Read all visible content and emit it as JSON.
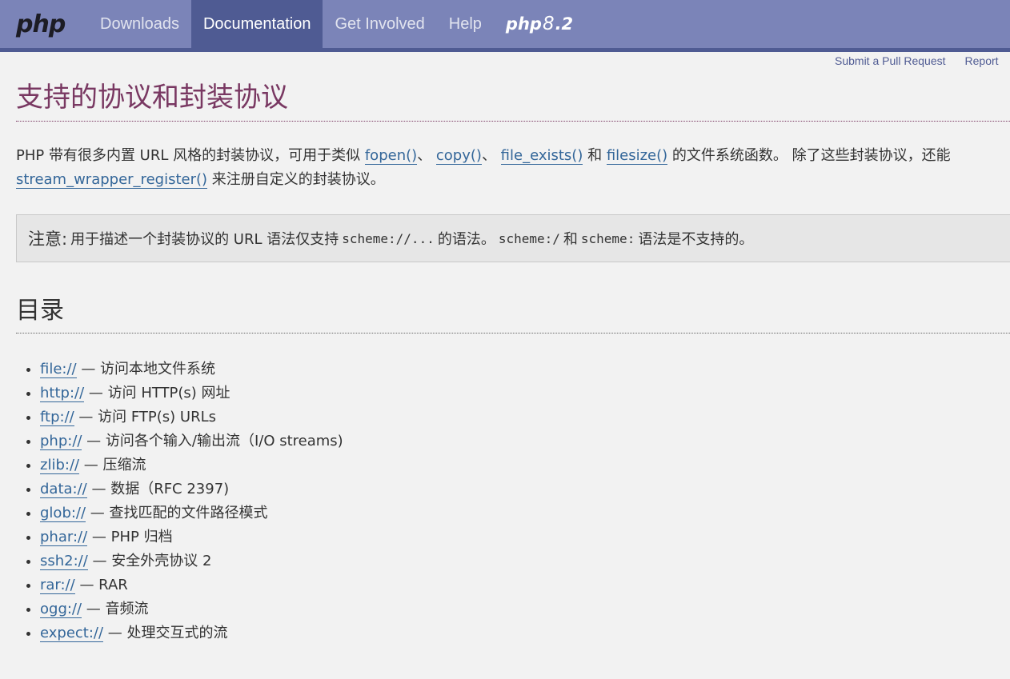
{
  "nav": {
    "logo": "php",
    "items": [
      {
        "label": "Downloads",
        "active": false
      },
      {
        "label": "Documentation",
        "active": true
      },
      {
        "label": "Get Involved",
        "active": false
      },
      {
        "label": "Help",
        "active": false
      }
    ],
    "version_prefix": "php",
    "version_major": "8",
    "version_suffix": ".2"
  },
  "toplinks": {
    "pull_request": "Submit a Pull Request",
    "report": "Report"
  },
  "page": {
    "title": "支持的协议和封装协议",
    "intro": {
      "t1": "PHP 带有很多内置 URL 风格的封装协议，可用于类似 ",
      "f1": "fopen()",
      "t2": "、 ",
      "f2": "copy()",
      "t3": "、 ",
      "f3": "file_exists()",
      "t4": " 和 ",
      "f4": "filesize()",
      "t5": " 的文件系统函数。 除了这些封装协议，还能",
      "f5": "stream_wrapper_register()",
      "t6": " 来注册自定义的封装协议。"
    },
    "note": {
      "label": "注意:",
      "t1": "用于描述一个封装协议的 URL 语法仅支持",
      "c1": "scheme://...",
      "t2": "的语法。",
      "c2": "scheme:/",
      "t3": "和",
      "c3": "scheme:",
      "t4": "语法是不支持的。"
    },
    "toc_title": "目录",
    "toc": [
      {
        "link": "file://",
        "desc": " — 访问本地文件系统"
      },
      {
        "link": "http://",
        "desc": " — 访问 HTTP(s) 网址"
      },
      {
        "link": "ftp://",
        "desc": " — 访问 FTP(s) URLs"
      },
      {
        "link": "php://",
        "desc": " — 访问各个输入/输出流（I/O streams)"
      },
      {
        "link": "zlib://",
        "desc": " — 压缩流"
      },
      {
        "link": "data://",
        "desc": " — 数据（RFC 2397)"
      },
      {
        "link": "glob://",
        "desc": " — 查找匹配的文件路径模式"
      },
      {
        "link": "phar://",
        "desc": " — PHP 归档"
      },
      {
        "link": "ssh2://",
        "desc": " — 安全外壳协议 2"
      },
      {
        "link": "rar://",
        "desc": " — RAR"
      },
      {
        "link": "ogg://",
        "desc": " — 音频流"
      },
      {
        "link": "expect://",
        "desc": " — 处理交互式的流"
      }
    ]
  }
}
